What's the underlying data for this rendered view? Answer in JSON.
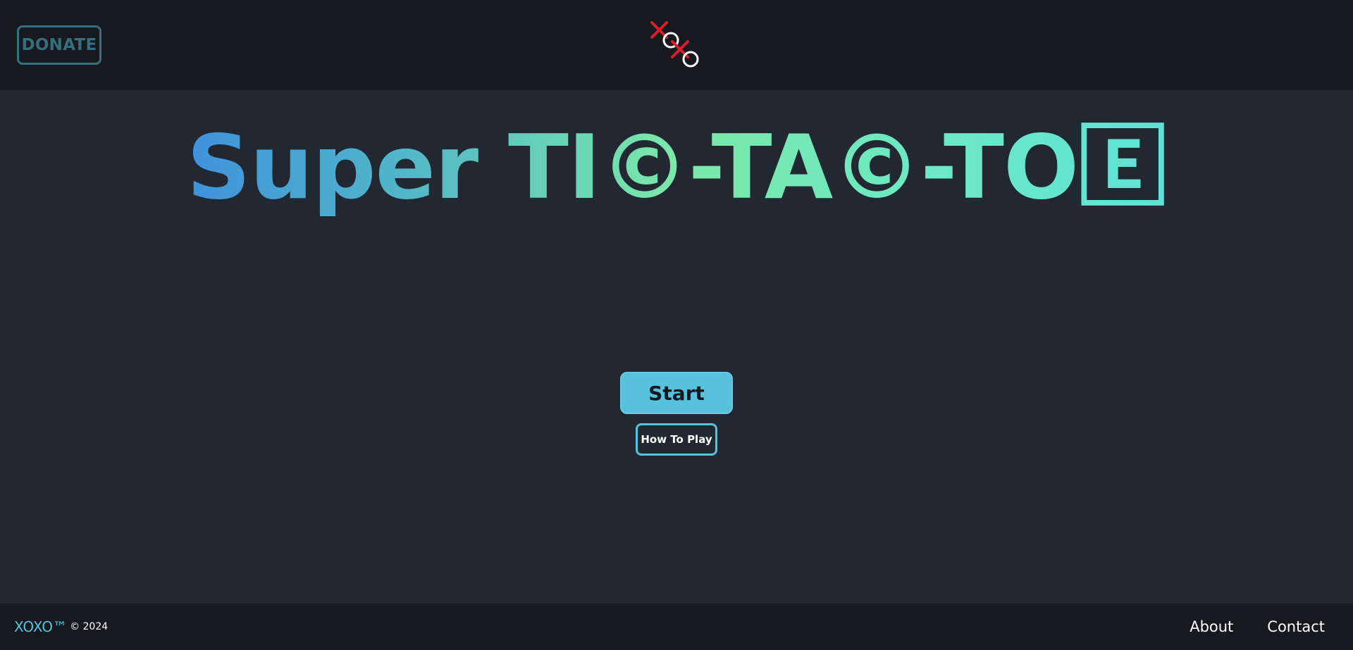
{
  "header": {
    "donate_label": "DONATE",
    "logo_icon": "xoxo-logo-icon"
  },
  "main": {
    "title": "Super TI©-TA©-TO🄴",
    "start_label": "Start",
    "how_to_play_label": "How To Play"
  },
  "footer": {
    "brand": "XOXO™",
    "copyright": "© 2024",
    "nav": [
      {
        "label": "About"
      },
      {
        "label": "Contact"
      }
    ]
  },
  "colors": {
    "background": "#222831",
    "header_footer": "#17191e",
    "accent": "#58c1dc",
    "donate": "#33707f",
    "x_mark": "#d81f2a",
    "gradient_start": "#3f92dc",
    "gradient_mid": "#7ce8a8",
    "gradient_end": "#5ee2d4"
  }
}
